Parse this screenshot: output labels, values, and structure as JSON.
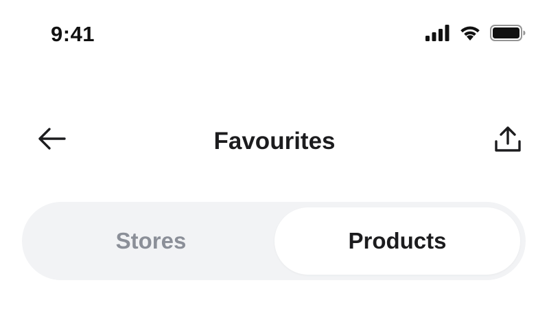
{
  "status_bar": {
    "time": "9:41",
    "icons": [
      "cellular-signal-icon",
      "wifi-icon",
      "battery-icon"
    ]
  },
  "nav": {
    "back_icon": "arrow-left-icon",
    "title": "Favourites",
    "share_icon": "share-upload-icon"
  },
  "tabs": {
    "items": [
      {
        "label": "Stores",
        "selected": false
      },
      {
        "label": "Products",
        "selected": true
      }
    ]
  },
  "colors": {
    "background": "#ffffff",
    "segment_track": "#f2f3f5",
    "selected_text": "#1c1c1e",
    "unselected_text": "#8b8f98"
  }
}
